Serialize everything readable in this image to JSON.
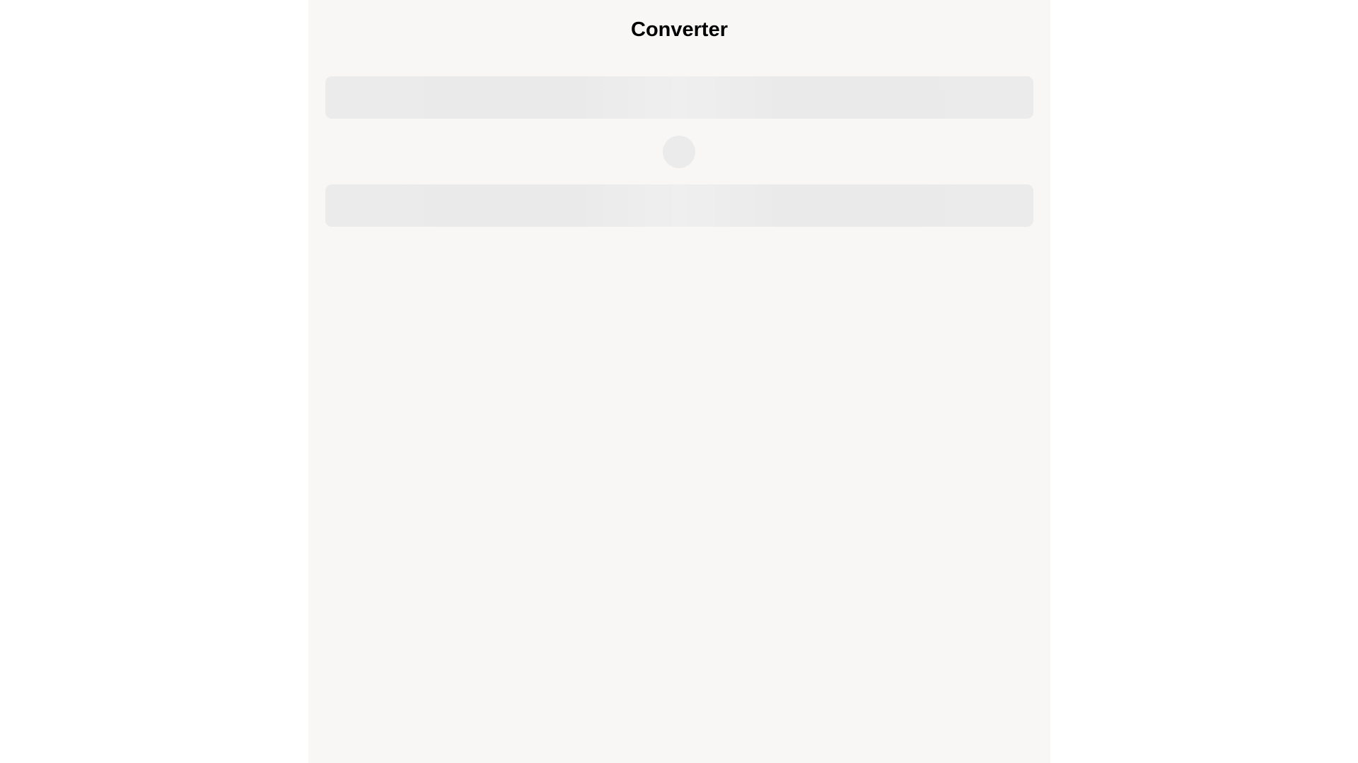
{
  "app": {
    "title": "Converter"
  },
  "state": {
    "loading": true
  },
  "colors": {
    "page_background": "#ffffff",
    "panel_background": "#f8f7f6",
    "skeleton": "#ebebeb",
    "title_text": "#000000"
  }
}
